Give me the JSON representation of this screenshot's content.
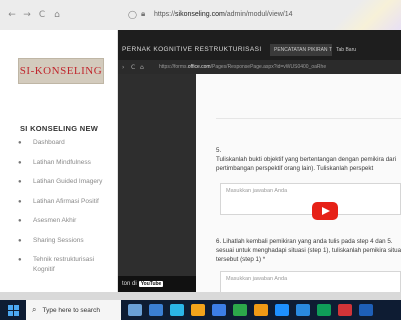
{
  "outer_browser": {
    "nav": [
      "←",
      "→",
      "C",
      "⌂"
    ],
    "url_prefix": "https://",
    "url_domain": "sikonseling.com",
    "url_path": "/admin/modul/view/14"
  },
  "sidebar": {
    "logo_text": "SI-KONSELING",
    "brand": "SI KONSELING NEW",
    "items": [
      {
        "label": "Dashboard"
      },
      {
        "label": "Latihan Mindfulness"
      },
      {
        "label": "Latihan Guided Imagery"
      },
      {
        "label": "Latihan Afirmasi Positif"
      },
      {
        "label": "Asesmen Akhir"
      },
      {
        "label": "Sharing Sessions"
      },
      {
        "label": "Tehnik restrukturisasi Kognitif"
      }
    ]
  },
  "inner_browser": {
    "tab_active": "PERNAK KOGNITIVE RESTRUKTURISASI",
    "tab_second": "PENCATATAN PIKIRAN TUBUH",
    "tab_third": "Tab Baru",
    "url_prefix": "https://forms.",
    "url_domain": "office.com",
    "url_path": "/Pages/ResponsePage.aspx?id=vWUS0400_oaRhe"
  },
  "form": {
    "q1": {
      "number": "5.",
      "text": "Tuliskanlah bukti objektif yang bertentangan dengan pemikira dari pertimbangan perspektif orang lain). Tuliskanlah perspekt",
      "placeholder": "Masukkan jawaban Anda"
    },
    "q2": {
      "number": "6.",
      "text": "Lihatlah kembali pemikiran yang anda tulis pada step 4 dan 5. sesuai untuk menghadapi situasi (step 1), tuliskanlah pemikira situasi tersebut (step 1) *",
      "placeholder": "Masukkan jawaban Anda"
    }
  },
  "youtube_bar": {
    "text": "ton di",
    "brand": "YouTube"
  },
  "taskbar": {
    "search_placeholder": "Type here to search",
    "icon_colors": [
      "#6ba0d6",
      "#3b7fd4",
      "#2bb5e8",
      "#f2a31b",
      "#3d7ee6",
      "#2ca84a",
      "#f09a16",
      "#1e90ff",
      "#2a8ae0",
      "#0f9d58",
      "#d13438",
      "#1e5fb8"
    ]
  }
}
